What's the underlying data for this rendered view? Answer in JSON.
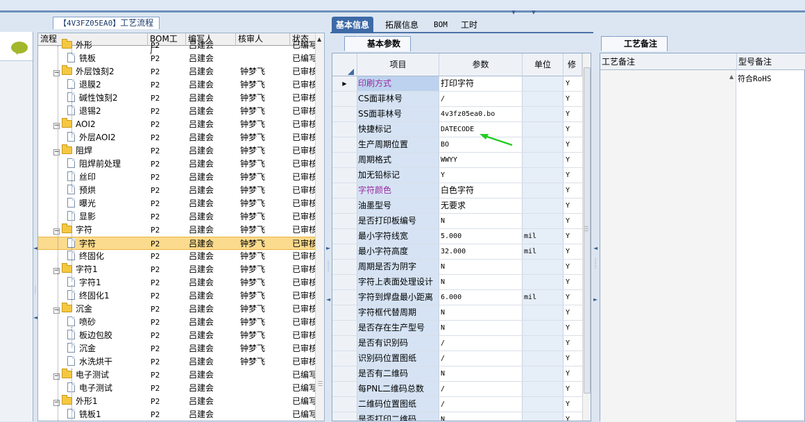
{
  "process_tab": {
    "code": "【4V3FZ05EA0】",
    "title": "工艺流程"
  },
  "tree": {
    "columns": [
      "流程",
      "BOM工厂",
      "编写人",
      "核审人",
      "状态"
    ],
    "rows": [
      {
        "level": 1,
        "kind": "folder",
        "name": "外形",
        "bom": "P2",
        "writer": "吕建会",
        "reviewer": "",
        "status": "已编写",
        "expander": "",
        "partial": true
      },
      {
        "level": 2,
        "kind": "doc",
        "name": "铣板",
        "bom": "P2",
        "writer": "吕建会",
        "reviewer": "",
        "status": "已编写"
      },
      {
        "level": 1,
        "kind": "folder",
        "name": "外层蚀刻2",
        "bom": "P2",
        "writer": "吕建会",
        "reviewer": "钟梦飞",
        "status": "已审核",
        "expander": "−"
      },
      {
        "level": 2,
        "kind": "doc",
        "name": "退膜2",
        "bom": "P2",
        "writer": "吕建会",
        "reviewer": "钟梦飞",
        "status": "已审核"
      },
      {
        "level": 2,
        "kind": "doc",
        "name": "碱性蚀刻2",
        "bom": "P2",
        "writer": "吕建会",
        "reviewer": "钟梦飞",
        "status": "已审核"
      },
      {
        "level": 2,
        "kind": "doc",
        "name": "退锡2",
        "bom": "P2",
        "writer": "吕建会",
        "reviewer": "钟梦飞",
        "status": "已审核"
      },
      {
        "level": 1,
        "kind": "folder",
        "name": "AOI2",
        "bom": "P2",
        "writer": "吕建会",
        "reviewer": "钟梦飞",
        "status": "已审核",
        "expander": "−"
      },
      {
        "level": 2,
        "kind": "doc",
        "name": "外层AOI2",
        "bom": "P2",
        "writer": "吕建会",
        "reviewer": "钟梦飞",
        "status": "已审核"
      },
      {
        "level": 1,
        "kind": "folder",
        "name": "阻焊",
        "bom": "P2",
        "writer": "吕建会",
        "reviewer": "钟梦飞",
        "status": "已审核",
        "expander": "−"
      },
      {
        "level": 2,
        "kind": "doc",
        "name": "阻焊前处理",
        "bom": "P2",
        "writer": "吕建会",
        "reviewer": "钟梦飞",
        "status": "已审核"
      },
      {
        "level": 2,
        "kind": "doc",
        "name": "丝印",
        "bom": "P2",
        "writer": "吕建会",
        "reviewer": "钟梦飞",
        "status": "已审核"
      },
      {
        "level": 2,
        "kind": "doc",
        "name": "预烘",
        "bom": "P2",
        "writer": "吕建会",
        "reviewer": "钟梦飞",
        "status": "已审核"
      },
      {
        "level": 2,
        "kind": "doc",
        "name": "曝光",
        "bom": "P2",
        "writer": "吕建会",
        "reviewer": "钟梦飞",
        "status": "已审核"
      },
      {
        "level": 2,
        "kind": "doc",
        "name": "显影",
        "bom": "P2",
        "writer": "吕建会",
        "reviewer": "钟梦飞",
        "status": "已审核"
      },
      {
        "level": 1,
        "kind": "folder",
        "name": "字符",
        "bom": "P2",
        "writer": "吕建会",
        "reviewer": "钟梦飞",
        "status": "已审核",
        "expander": "−"
      },
      {
        "level": 2,
        "kind": "doc",
        "name": "字符",
        "bom": "P2",
        "writer": "吕建会",
        "reviewer": "钟梦飞",
        "status": "已审核",
        "selected": true
      },
      {
        "level": 2,
        "kind": "doc",
        "name": "终固化",
        "bom": "P2",
        "writer": "吕建会",
        "reviewer": "钟梦飞",
        "status": "已审核"
      },
      {
        "level": 1,
        "kind": "folder",
        "name": "字符1",
        "bom": "P2",
        "writer": "吕建会",
        "reviewer": "钟梦飞",
        "status": "已审核",
        "expander": "−"
      },
      {
        "level": 2,
        "kind": "doc",
        "name": "字符1",
        "bom": "P2",
        "writer": "吕建会",
        "reviewer": "钟梦飞",
        "status": "已审核"
      },
      {
        "level": 2,
        "kind": "doc",
        "name": "终固化1",
        "bom": "P2",
        "writer": "吕建会",
        "reviewer": "钟梦飞",
        "status": "已审核"
      },
      {
        "level": 1,
        "kind": "folder",
        "name": "沉金",
        "bom": "P2",
        "writer": "吕建会",
        "reviewer": "钟梦飞",
        "status": "已审核",
        "expander": "−"
      },
      {
        "level": 2,
        "kind": "doc",
        "name": "喷砂",
        "bom": "P2",
        "writer": "吕建会",
        "reviewer": "钟梦飞",
        "status": "已审核"
      },
      {
        "level": 2,
        "kind": "doc",
        "name": "板边包胶",
        "bom": "P2",
        "writer": "吕建会",
        "reviewer": "钟梦飞",
        "status": "已审核"
      },
      {
        "level": 2,
        "kind": "doc",
        "name": "沉金",
        "bom": "P2",
        "writer": "吕建会",
        "reviewer": "钟梦飞",
        "status": "已审核"
      },
      {
        "level": 2,
        "kind": "doc",
        "name": "水洗烘干",
        "bom": "P2",
        "writer": "吕建会",
        "reviewer": "钟梦飞",
        "status": "已审核"
      },
      {
        "level": 1,
        "kind": "folder",
        "name": "电子测试",
        "bom": "P2",
        "writer": "吕建会",
        "reviewer": "",
        "status": "已编写",
        "expander": "−"
      },
      {
        "level": 2,
        "kind": "doc",
        "name": "电子测试",
        "bom": "P2",
        "writer": "吕建会",
        "reviewer": "",
        "status": "已编写"
      },
      {
        "level": 1,
        "kind": "folder",
        "name": "外形1",
        "bom": "P2",
        "writer": "吕建会",
        "reviewer": "",
        "status": "已编写",
        "expander": "−"
      },
      {
        "level": 2,
        "kind": "doc",
        "name": "铣板1",
        "bom": "P2",
        "writer": "吕建会",
        "reviewer": "",
        "status": "已编写"
      }
    ]
  },
  "main_tabs": [
    "基本信息",
    "拓展信息",
    "BOM",
    "工时"
  ],
  "sub_tab": "基本参数",
  "param_grid": {
    "columns": [
      "项目",
      "参数",
      "单位",
      "修"
    ],
    "rows": [
      {
        "item": "印刷方式",
        "param": "打印字符",
        "unit": "",
        "last": "Y",
        "purple": true,
        "current": true
      },
      {
        "item": "CS面菲林号",
        "param": "/",
        "unit": "",
        "last": "Y"
      },
      {
        "item": "SS面菲林号",
        "param": "4v3fz05ea0.bo",
        "unit": "",
        "last": "Y"
      },
      {
        "item": "快捷标记",
        "param": "DATECODE",
        "unit": "",
        "last": "Y"
      },
      {
        "item": "生产周期位置",
        "param": "BO",
        "unit": "",
        "last": "Y"
      },
      {
        "item": "周期格式",
        "param": "WWYY",
        "unit": "",
        "last": "Y"
      },
      {
        "item": "加无铅标记",
        "param": "Y",
        "unit": "",
        "last": "Y"
      },
      {
        "item": "字符颜色",
        "param": "白色字符",
        "unit": "",
        "last": "Y",
        "purple": true
      },
      {
        "item": "油墨型号",
        "param": "无要求",
        "unit": "",
        "last": "Y"
      },
      {
        "item": "是否打印板编号",
        "param": "N",
        "unit": "",
        "last": "Y"
      },
      {
        "item": "最小字符线宽",
        "param": "5.000",
        "unit": "mil",
        "last": "Y"
      },
      {
        "item": "最小字符高度",
        "param": "32.000",
        "unit": "mil",
        "last": "Y"
      },
      {
        "item": "周期是否为阴字",
        "param": "N",
        "unit": "",
        "last": "Y"
      },
      {
        "item": "字符上表面处理设计",
        "param": "N",
        "unit": "",
        "last": "Y"
      },
      {
        "item": "字符到焊盘最小距离",
        "param": "6.000",
        "unit": "mil",
        "last": "Y"
      },
      {
        "item": "字符框代替周期",
        "param": "N",
        "unit": "",
        "last": "Y"
      },
      {
        "item": "是否存在生产型号",
        "param": "N",
        "unit": "",
        "last": "Y"
      },
      {
        "item": "是否有识别码",
        "param": "/",
        "unit": "",
        "last": "Y"
      },
      {
        "item": "识别码位置图纸",
        "param": "/",
        "unit": "",
        "last": "Y"
      },
      {
        "item": "是否有二维码",
        "param": "N",
        "unit": "",
        "last": "Y"
      },
      {
        "item": "每PNL二维码总数",
        "param": "/",
        "unit": "",
        "last": "Y"
      },
      {
        "item": "二维码位置图纸",
        "param": "/",
        "unit": "",
        "last": "Y"
      },
      {
        "item": "是否打印二维码",
        "param": "N",
        "unit": "",
        "last": "Y"
      }
    ]
  },
  "remarks": {
    "tab": "工艺备注",
    "col1": "工艺备注",
    "col2": "型号备注",
    "model_remark": "符合RoHS"
  },
  "colors": {
    "accent": "#3d6aa6",
    "selected_row": "#fbdb8d",
    "purple_text": "#9c2a9e",
    "arrow": "#22cc22"
  }
}
